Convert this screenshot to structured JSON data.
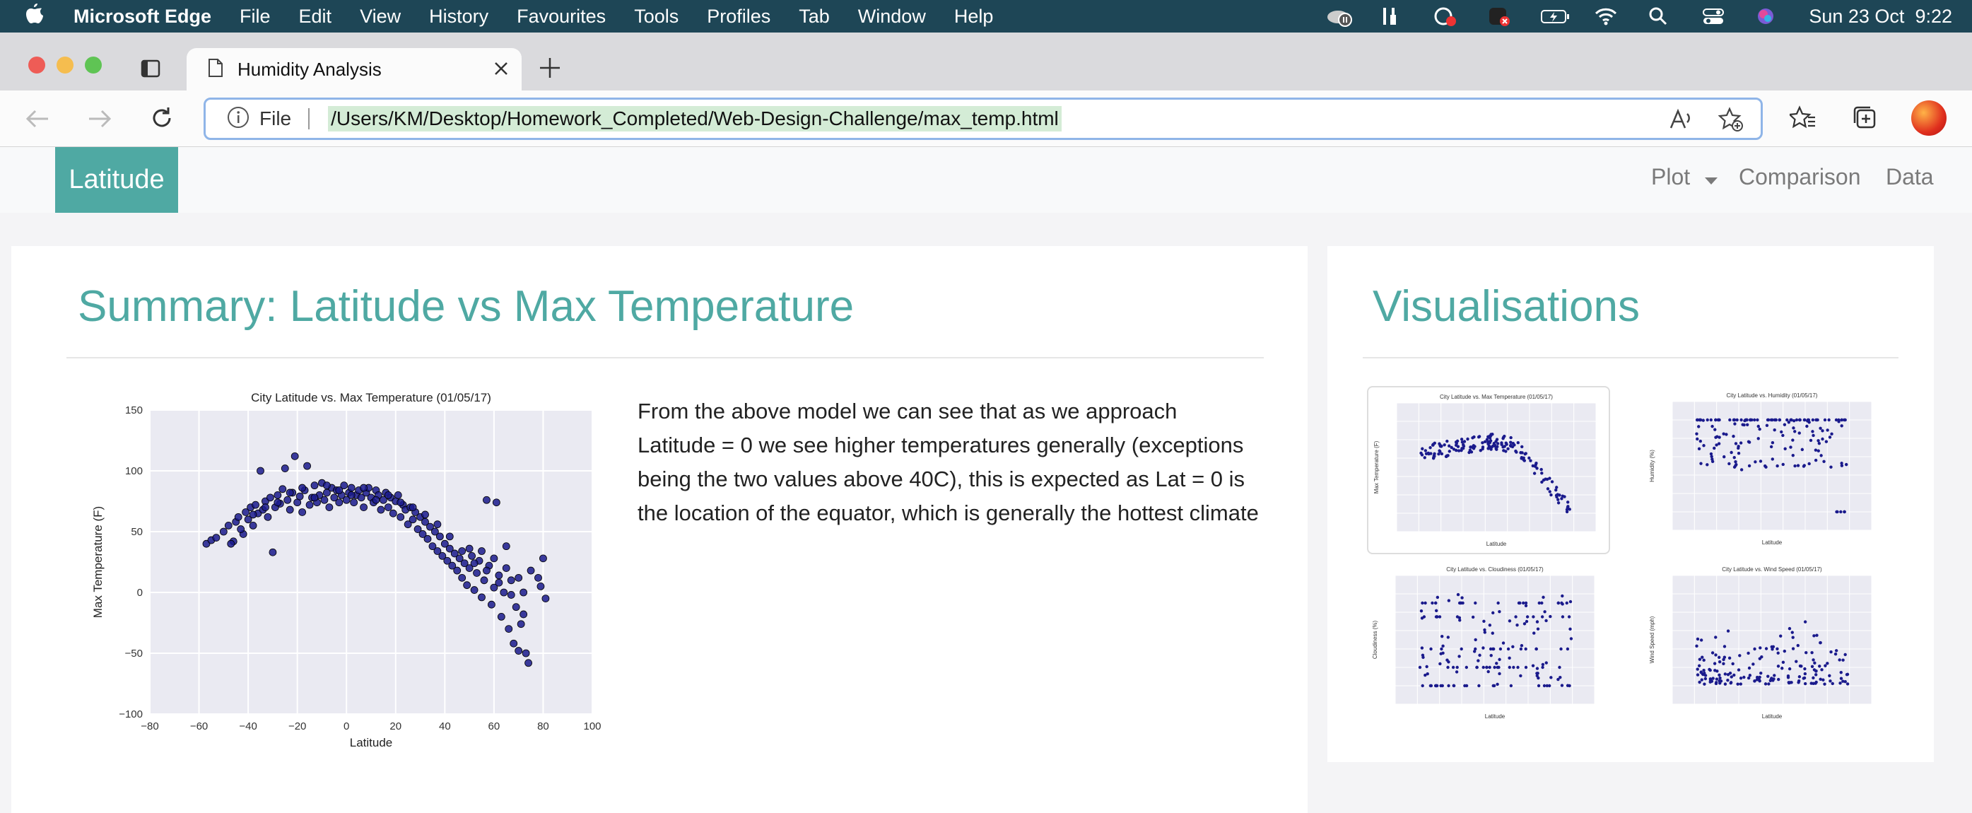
{
  "menubar": {
    "app_name": "Microsoft Edge",
    "items": [
      "File",
      "Edit",
      "View",
      "History",
      "Favourites",
      "Tools",
      "Profiles",
      "Tab",
      "Window",
      "Help"
    ],
    "clock": "Sun 23 Oct  9:22"
  },
  "browser": {
    "tab_title": "Humidity Analysis",
    "address_prefix": "File",
    "url": "/Users/KM/Desktop/Homework_Completed/Web-Design-Challenge/max_temp.html"
  },
  "site_nav": {
    "brand": "Latitude",
    "links": [
      "Plot",
      "Comparison",
      "Data"
    ]
  },
  "summary": {
    "title": "Summary: Latitude vs Max Temperature",
    "text": "From the above model we can see that as we approach Latitude = 0 we see higher temperatures generally (exceptions being the two values above 40C), this is expected as Lat = 0 is the location of the equator, which is generally the hottest climate"
  },
  "visualisations": {
    "title": "Visualisations"
  },
  "colors": {
    "accent": "#4fa9a3",
    "menubar": "#1e4656",
    "plot_bg": "#eaeaf2",
    "point": "#1a1a8c"
  },
  "chart_data": [
    {
      "type": "scatter",
      "title": "City Latitude vs. Max Temperature (01/05/17)",
      "xlabel": "Latitude",
      "ylabel": "Max Temperature (F)",
      "xlim": [
        -80,
        100
      ],
      "ylim": [
        -100,
        150
      ],
      "xticks": [
        -80,
        -60,
        -40,
        -20,
        0,
        20,
        40,
        60,
        80,
        100
      ],
      "yticks": [
        -100,
        -50,
        0,
        50,
        100,
        150
      ],
      "grid": true,
      "trend": "roughly flat at 60 to 85 F between latitude -50 and 30, then falling steeply to about -60 F near latitude 75",
      "series": [
        {
          "points": [
            [
              -57,
              40
            ],
            [
              -55,
              43
            ],
            [
              -53,
              45
            ],
            [
              -50,
              50
            ],
            [
              -48,
              55
            ],
            [
              -46,
              42
            ],
            [
              -45,
              58
            ],
            [
              -44,
              62
            ],
            [
              -42,
              48
            ],
            [
              -41,
              66
            ],
            [
              -40,
              60
            ],
            [
              -39,
              70
            ],
            [
              -38,
              55
            ],
            [
              -37,
              72
            ],
            [
              -36,
              65
            ],
            [
              -35,
              100
            ],
            [
              -34,
              68
            ],
            [
              -33,
              75
            ],
            [
              -32,
              62
            ],
            [
              -31,
              78
            ],
            [
              -30,
              33
            ],
            [
              -29,
              70
            ],
            [
              -28,
              80
            ],
            [
              -27,
              73
            ],
            [
              -26,
              85
            ],
            [
              -25,
              102
            ],
            [
              -24,
              76
            ],
            [
              -23,
              68
            ],
            [
              -22,
              82
            ],
            [
              -21,
              112
            ],
            [
              -20,
              74
            ],
            [
              -19,
              79
            ],
            [
              -18,
              66
            ],
            [
              -17,
              84
            ],
            [
              -16,
              104
            ],
            [
              -15,
              72
            ],
            [
              -14,
              78
            ],
            [
              -13,
              88
            ],
            [
              -12,
              74
            ],
            [
              -11,
              80
            ],
            [
              -10,
              90
            ],
            [
              -9,
              76
            ],
            [
              -8,
              82
            ],
            [
              -7,
              70
            ],
            [
              -6,
              86
            ],
            [
              -5,
              78
            ],
            [
              -4,
              84
            ],
            [
              -3,
              74
            ],
            [
              -2,
              80
            ],
            [
              -1,
              88
            ],
            [
              0,
              76
            ],
            [
              1,
              82
            ],
            [
              2,
              86
            ],
            [
              3,
              74
            ],
            [
              4,
              80
            ],
            [
              5,
              84
            ],
            [
              6,
              78
            ],
            [
              7,
              70
            ],
            [
              8,
              82
            ],
            [
              9,
              86
            ],
            [
              10,
              78
            ],
            [
              11,
              74
            ],
            [
              12,
              84
            ],
            [
              13,
              80
            ],
            [
              14,
              68
            ],
            [
              15,
              76
            ],
            [
              16,
              82
            ],
            [
              17,
              70
            ],
            [
              18,
              78
            ],
            [
              19,
              65
            ],
            [
              20,
              75
            ],
            [
              21,
              80
            ],
            [
              22,
              62
            ],
            [
              23,
              72
            ],
            [
              24,
              68
            ],
            [
              25,
              56
            ],
            [
              26,
              70
            ],
            [
              27,
              60
            ],
            [
              28,
              66
            ],
            [
              29,
              52
            ],
            [
              30,
              62
            ],
            [
              31,
              48
            ],
            [
              32,
              58
            ],
            [
              33,
              44
            ],
            [
              34,
              54
            ],
            [
              35,
              38
            ],
            [
              36,
              50
            ],
            [
              37,
              34
            ],
            [
              38,
              46
            ],
            [
              39,
              30
            ],
            [
              40,
              40
            ],
            [
              41,
              26
            ],
            [
              42,
              36
            ],
            [
              43,
              22
            ],
            [
              44,
              32
            ],
            [
              45,
              18
            ],
            [
              46,
              28
            ],
            [
              47,
              12
            ],
            [
              48,
              24
            ],
            [
              49,
              6
            ],
            [
              50,
              20
            ],
            [
              51,
              30
            ],
            [
              52,
              2
            ],
            [
              53,
              16
            ],
            [
              54,
              26
            ],
            [
              55,
              -4
            ],
            [
              56,
              10
            ],
            [
              57,
              76
            ],
            [
              58,
              22
            ],
            [
              59,
              -10
            ],
            [
              60,
              4
            ],
            [
              61,
              74
            ],
            [
              62,
              14
            ],
            [
              63,
              -20
            ],
            [
              64,
              0
            ],
            [
              65,
              38
            ],
            [
              66,
              -30
            ],
            [
              67,
              10
            ],
            [
              68,
              -42
            ],
            [
              69,
              -12
            ],
            [
              70,
              -48
            ],
            [
              71,
              -26
            ],
            [
              72,
              0
            ],
            [
              73,
              -50
            ],
            [
              74,
              -58
            ],
            [
              75,
              18
            ],
            [
              78,
              12
            ],
            [
              80,
              28
            ],
            [
              81,
              -5
            ],
            [
              79,
              5
            ],
            [
              -47,
              40
            ],
            [
              -43,
              52
            ],
            [
              -38,
              64
            ],
            [
              -33,
              70
            ],
            [
              -28,
              74
            ],
            [
              -23,
              82
            ],
            [
              -18,
              86
            ],
            [
              -13,
              78
            ],
            [
              -8,
              88
            ],
            [
              -3,
              84
            ],
            [
              2,
              80
            ],
            [
              7,
              86
            ],
            [
              12,
              76
            ],
            [
              17,
              80
            ],
            [
              22,
              74
            ],
            [
              27,
              70
            ],
            [
              32,
              64
            ],
            [
              37,
              56
            ],
            [
              42,
              46
            ],
            [
              47,
              34
            ],
            [
              52,
              24
            ],
            [
              57,
              18
            ],
            [
              62,
              8
            ],
            [
              67,
              -2
            ],
            [
              72,
              -18
            ],
            [
              55,
              34
            ],
            [
              60,
              28
            ],
            [
              65,
              20
            ],
            [
              70,
              12
            ],
            [
              50,
              36
            ]
          ]
        }
      ]
    },
    {
      "type": "scatter",
      "title": "City Latitude vs. Max Temperature (01/05/17)",
      "xlim": [
        -80,
        100
      ],
      "ylim": [
        -100,
        150
      ],
      "xlabel": "Latitude",
      "ylabel": "Max Temperature (F)"
    },
    {
      "type": "scatter",
      "title": "City Latitude vs. Humidity (01/05/17)",
      "xlim": [
        -80,
        100
      ],
      "ylim": [
        -20,
        120
      ],
      "xlabel": "Latitude",
      "ylabel": "Humidity (%)"
    },
    {
      "type": "scatter",
      "title": "City Latitude vs. Cloudiness (01/05/17)",
      "xlim": [
        -80,
        100
      ],
      "ylim": [
        -20,
        120
      ],
      "xlabel": "Latitude",
      "ylabel": "Cloudiness (%)"
    },
    {
      "type": "scatter",
      "title": "City Latitude vs. Wind Speed (01/05/17)",
      "xlim": [
        -80,
        100
      ],
      "ylim": [
        -5,
        40
      ],
      "xlabel": "Latitude",
      "ylabel": "Wind Speed (mph)"
    }
  ]
}
